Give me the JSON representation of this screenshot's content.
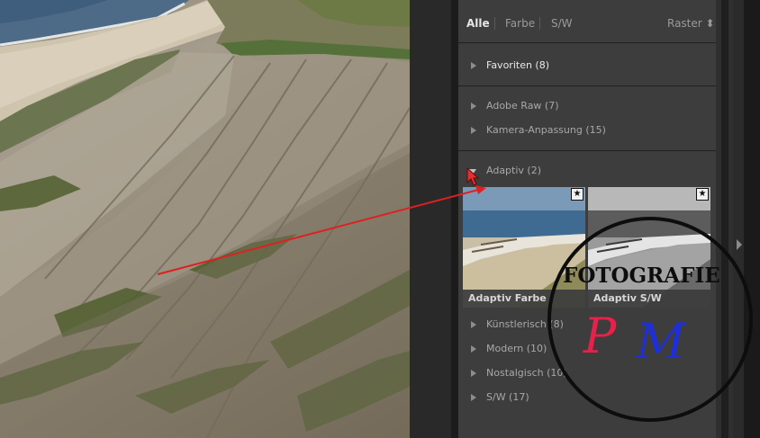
{
  "filter_bar": {
    "all": "Alle",
    "color": "Farbe",
    "bw": "S/W",
    "layout": "Raster ⬍"
  },
  "groups": {
    "favorites": "Favoriten (8)",
    "adobe_raw": "Adobe Raw (7)",
    "camera_matching": "Kamera-Anpassung (15)",
    "adaptive": "Adaptiv (2)",
    "artistic": "Künstlerisch (8)",
    "modern": "Modern (10)",
    "nostalgic": "Nostalgisch (10)",
    "bw": "S/W (17)"
  },
  "thumbnails": [
    {
      "caption": "Adaptiv Farbe",
      "starred": true
    },
    {
      "caption": "Adaptiv S/W",
      "starred": true
    }
  ],
  "watermark": {
    "text": "FOTOGRAFIE",
    "initials_p": "P",
    "initials_m": "M"
  },
  "icons": {
    "star": "★",
    "expand": "triangle-right-icon",
    "collapse": "triangle-down-icon"
  },
  "colors": {
    "panel_bg": "#3d3d3d",
    "annotation_arrow": "#e02020",
    "initial_p": "#e8204a",
    "initial_m": "#1f2fd8"
  }
}
